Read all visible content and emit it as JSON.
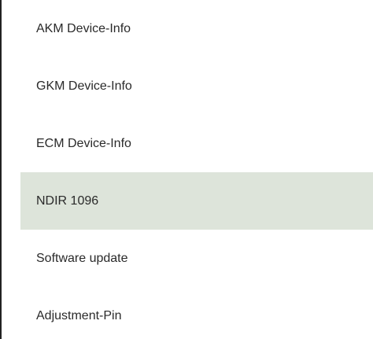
{
  "menu": {
    "items": [
      {
        "label": "AKM Device-Info",
        "selected": false
      },
      {
        "label": "GKM Device-Info",
        "selected": false
      },
      {
        "label": "ECM Device-Info",
        "selected": false
      },
      {
        "label": "NDIR 1096",
        "selected": true
      },
      {
        "label": "Software update",
        "selected": false
      },
      {
        "label": "Adjustment-Pin",
        "selected": false
      }
    ]
  },
  "colors": {
    "selected_background": "#dde4da",
    "text": "#2a2a2a",
    "border": "#222222",
    "background": "#ffffff"
  }
}
